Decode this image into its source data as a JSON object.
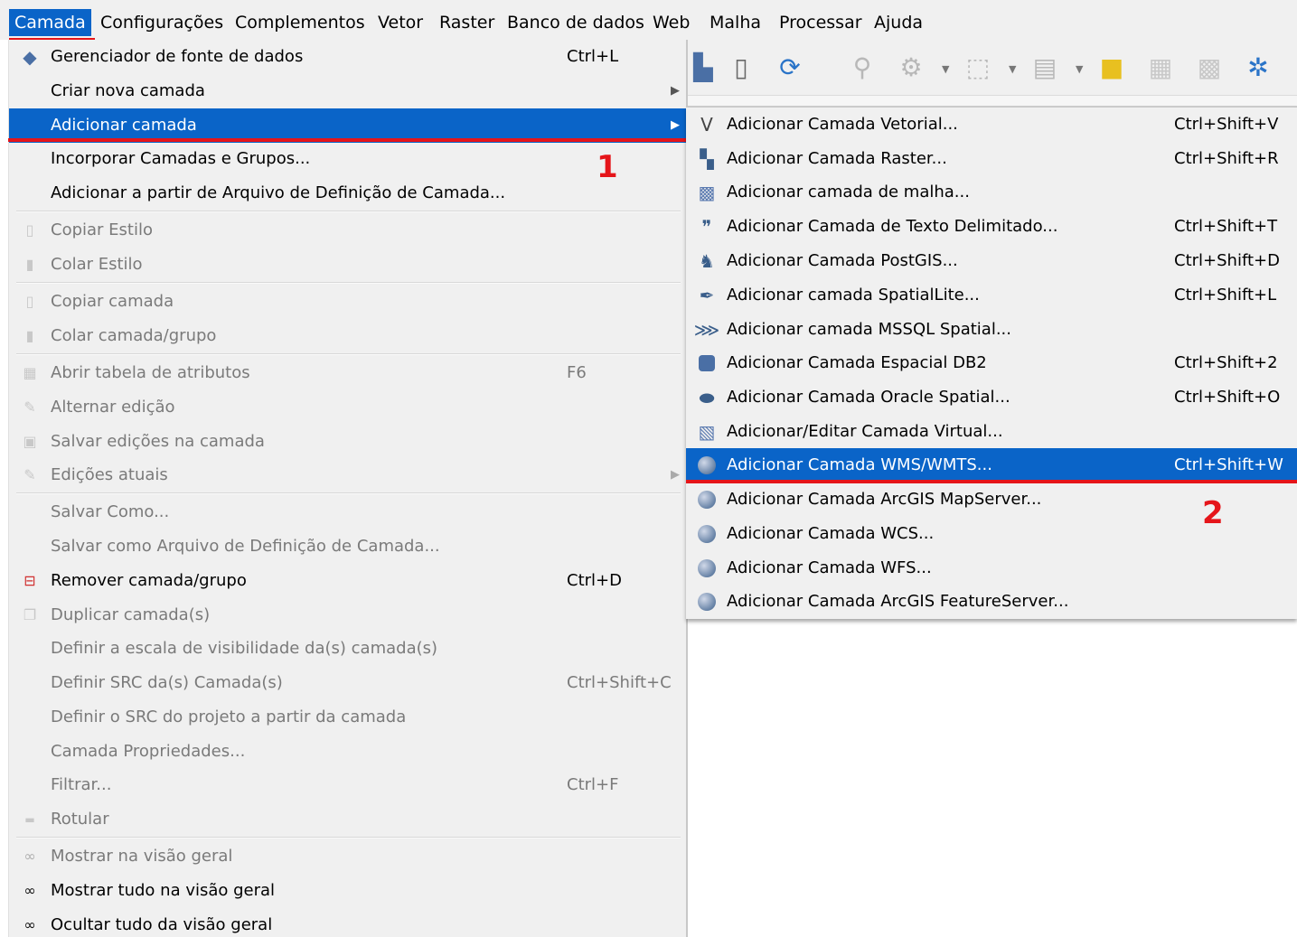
{
  "menubar": {
    "items": [
      "Camada",
      "Configurações",
      "Complementos",
      "Vetor",
      "Raster",
      "Banco de dados",
      "Web",
      "Malha",
      "Processar",
      "Ajuda"
    ],
    "active_index": 0
  },
  "toolbar": {
    "icons": [
      "layer-icon",
      "bookmark-icon",
      "refresh-icon",
      "identify-icon",
      "zoom-icon",
      "select-icon",
      "table-icon",
      "remove-layer-icon",
      "attributes-icon",
      "calculator-icon",
      "settings-icon"
    ]
  },
  "main_menu": {
    "items": [
      {
        "label": "Gerenciador de fonte de dados",
        "shortcut": "Ctrl+L",
        "enabled": true,
        "icon": "data-source-manager-icon"
      },
      {
        "label": "Criar nova camada",
        "shortcut": "",
        "enabled": true,
        "submenu": true
      },
      {
        "label": "Adicionar camada",
        "shortcut": "",
        "enabled": true,
        "submenu": true,
        "highlighted": true
      },
      {
        "label": "Incorporar Camadas e Grupos...",
        "shortcut": "",
        "enabled": true
      },
      {
        "label": "Adicionar a partir de Arquivo de Definição de Camada...",
        "shortcut": "",
        "enabled": true
      },
      {
        "label": "Copiar Estilo",
        "shortcut": "",
        "enabled": false,
        "icon": "copy-style-icon"
      },
      {
        "label": "Colar Estilo",
        "shortcut": "",
        "enabled": false,
        "icon": "paste-style-icon"
      },
      {
        "label": "Copiar camada",
        "shortcut": "",
        "enabled": false,
        "icon": "copy-layer-icon"
      },
      {
        "label": "Colar camada/grupo",
        "shortcut": "",
        "enabled": false,
        "icon": "paste-layer-icon"
      },
      {
        "label": "Abrir tabela de atributos",
        "shortcut": "F6",
        "enabled": false,
        "icon": "attribute-table-icon"
      },
      {
        "label": "Alternar edição",
        "shortcut": "",
        "enabled": false,
        "icon": "pencil-icon"
      },
      {
        "label": "Salvar edições na camada",
        "shortcut": "",
        "enabled": false,
        "icon": "save-edits-icon"
      },
      {
        "label": "Edições atuais",
        "shortcut": "",
        "enabled": false,
        "submenu": true,
        "icon": "current-edits-icon"
      },
      {
        "label": "Salvar Como...",
        "shortcut": "",
        "enabled": false
      },
      {
        "label": "Salvar como Arquivo de Definição de Camada...",
        "shortcut": "",
        "enabled": false
      },
      {
        "label": "Remover camada/grupo",
        "shortcut": "Ctrl+D",
        "enabled": true,
        "icon": "remove-layer-icon"
      },
      {
        "label": "Duplicar camada(s)",
        "shortcut": "",
        "enabled": false,
        "icon": "duplicate-layer-icon"
      },
      {
        "label": "Definir a escala de visibilidade da(s) camada(s)",
        "shortcut": "",
        "enabled": false
      },
      {
        "label": "Definir SRC da(s) Camada(s)",
        "shortcut": "Ctrl+Shift+C",
        "enabled": false
      },
      {
        "label": "Definir o SRC do projeto a partir da camada",
        "shortcut": "",
        "enabled": false
      },
      {
        "label": "Camada Propriedades...",
        "shortcut": "",
        "enabled": false
      },
      {
        "label": "Filtrar...",
        "shortcut": "Ctrl+F",
        "enabled": false
      },
      {
        "label": "Rotular",
        "shortcut": "",
        "enabled": false,
        "icon": "label-icon"
      },
      {
        "label": "Mostrar na visão geral",
        "shortcut": "",
        "enabled": false,
        "icon": "overview-icon"
      },
      {
        "label": "Mostrar tudo na visão geral",
        "shortcut": "",
        "enabled": true,
        "icon": "show-all-overview-icon"
      },
      {
        "label": "Ocultar tudo da visão geral",
        "shortcut": "",
        "enabled": true,
        "icon": "hide-all-overview-icon"
      }
    ]
  },
  "sub_menu": {
    "items": [
      {
        "label": "Adicionar Camada Vetorial...",
        "shortcut": "Ctrl+Shift+V",
        "icon": "vector-layer-icon"
      },
      {
        "label": "Adicionar Camada Raster...",
        "shortcut": "Ctrl+Shift+R",
        "icon": "raster-layer-icon"
      },
      {
        "label": "Adicionar camada de malha...",
        "shortcut": "",
        "icon": "mesh-layer-icon"
      },
      {
        "label": "Adicionar Camada de Texto Delimitado...",
        "shortcut": "Ctrl+Shift+T",
        "icon": "delimited-text-icon"
      },
      {
        "label": "Adicionar Camada PostGIS...",
        "shortcut": "Ctrl+Shift+D",
        "icon": "postgis-icon"
      },
      {
        "label": "Adicionar camada SpatialLite...",
        "shortcut": "Ctrl+Shift+L",
        "icon": "spatialite-icon"
      },
      {
        "label": "Adicionar camada MSSQL Spatial...",
        "shortcut": "",
        "icon": "mssql-icon"
      },
      {
        "label": "Adicionar Camada Espacial DB2",
        "shortcut": "Ctrl+Shift+2",
        "icon": "db2-icon"
      },
      {
        "label": "Adicionar Camada Oracle Spatial...",
        "shortcut": "Ctrl+Shift+O",
        "icon": "oracle-icon"
      },
      {
        "label": "Adicionar/Editar Camada Virtual...",
        "shortcut": "",
        "icon": "virtual-layer-icon"
      },
      {
        "label": "Adicionar Camada WMS/WMTS...",
        "shortcut": "Ctrl+Shift+W",
        "icon": "wms-icon",
        "highlighted": true
      },
      {
        "label": "Adicionar Camada ArcGIS MapServer...",
        "shortcut": "",
        "icon": "arcgis-mapserver-icon"
      },
      {
        "label": "Adicionar Camada WCS...",
        "shortcut": "",
        "icon": "wcs-icon"
      },
      {
        "label": "Adicionar Camada WFS...",
        "shortcut": "",
        "icon": "wfs-icon"
      },
      {
        "label": "Adicionar Camada ArcGIS FeatureServer...",
        "shortcut": "",
        "icon": "arcgis-featureserver-icon"
      }
    ]
  },
  "annotations": {
    "step1": "1",
    "step2": "2"
  },
  "colors": {
    "highlight": "#0a64c8",
    "annotation_red": "#e5151a",
    "menu_bg": "#f0f0f0",
    "disabled_text": "#7a7a7a"
  }
}
